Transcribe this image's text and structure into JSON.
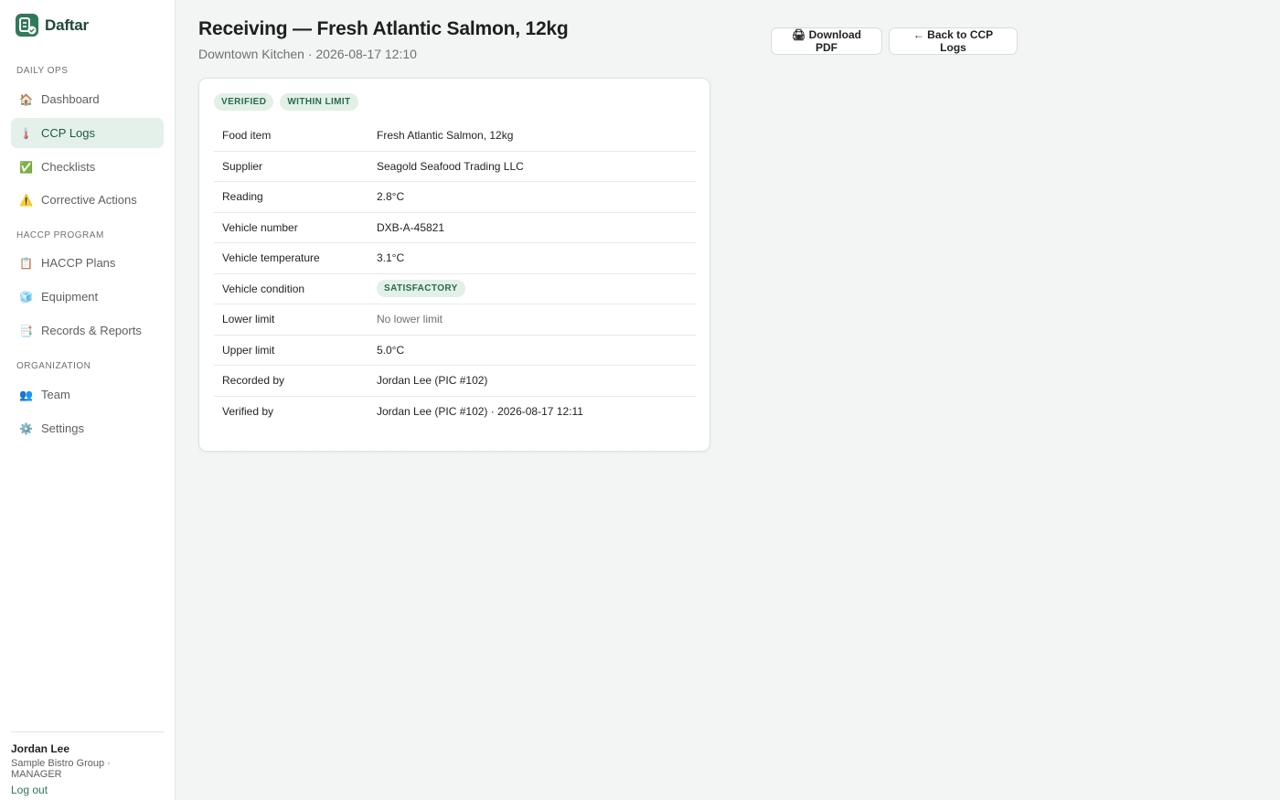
{
  "brand": {
    "name": "Daftar"
  },
  "sidebar": {
    "sections": [
      {
        "label": "DAILY OPS"
      },
      {
        "label": "HACCP PROGRAM"
      },
      {
        "label": "ORGANIZATION"
      }
    ],
    "items": [
      {
        "label": "Dashboard",
        "icon": "🏠"
      },
      {
        "label": "CCP Logs",
        "icon": "🌡️"
      },
      {
        "label": "Checklists",
        "icon": "✅"
      },
      {
        "label": "Corrective Actions",
        "icon": "⚠️"
      },
      {
        "label": "HACCP Plans",
        "icon": "📋"
      },
      {
        "label": "Equipment",
        "icon": "🧊"
      },
      {
        "label": "Records & Reports",
        "icon": "📑"
      },
      {
        "label": "Team",
        "icon": "👥"
      },
      {
        "label": "Settings",
        "icon": "⚙️"
      }
    ],
    "active_item": "CCP Logs"
  },
  "user": {
    "name": "Jordan Lee",
    "org": "Sample Bistro Group · MANAGER",
    "logout_label": "Log out"
  },
  "header": {
    "title": "Receiving — Fresh Atlantic Salmon, 12kg",
    "subtitle": "Downtown Kitchen · 2026-08-17 12:10",
    "download_label": "🖨 Download PDF",
    "back_label": "← Back to CCP Logs"
  },
  "record": {
    "badges": [
      "VERIFIED",
      "WITHIN LIMIT"
    ],
    "rows": [
      {
        "label": "Food item",
        "value": "Fresh Atlantic Salmon, 12kg"
      },
      {
        "label": "Supplier",
        "value": "Seagold Seafood Trading LLC"
      },
      {
        "label": "Reading",
        "value": "2.8°C"
      },
      {
        "label": "Vehicle number",
        "value": "DXB-A-45821"
      },
      {
        "label": "Vehicle temperature",
        "value": "3.1°C"
      },
      {
        "label": "Vehicle condition",
        "value": "SATISFACTORY"
      },
      {
        "label": "Lower limit",
        "value": "No lower limit"
      },
      {
        "label": "Upper limit",
        "value": "5.0°C"
      },
      {
        "label": "Recorded by",
        "value": "Jordan Lee (PIC #102)"
      },
      {
        "label": "Verified by",
        "value": "Jordan Lee (PIC #102) · 2026-08-17 12:11"
      }
    ]
  },
  "colors": {
    "accent": "#2f7a5a",
    "badge_bg": "#e2f0e8",
    "active_nav_bg": "#e4f1ea"
  }
}
